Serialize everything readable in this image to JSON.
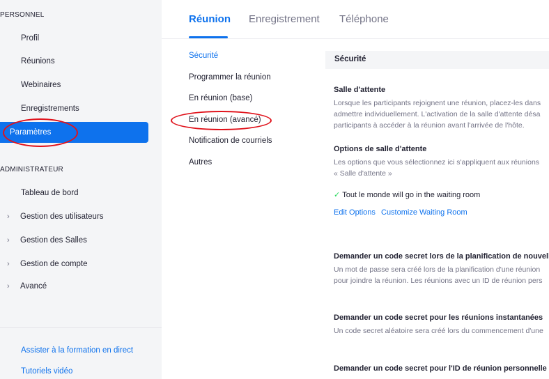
{
  "sidebar": {
    "section_personal": "PERSONNEL",
    "personal_items": [
      {
        "label": "Profil"
      },
      {
        "label": "Réunions"
      },
      {
        "label": "Webinaires"
      },
      {
        "label": "Enregistrements"
      },
      {
        "label": "Paramètres"
      }
    ],
    "section_admin": "ADMINISTRATEUR",
    "admin_items": [
      {
        "label": "Tableau de bord"
      },
      {
        "label": "Gestion des utilisateurs"
      },
      {
        "label": "Gestion des Salles"
      },
      {
        "label": "Gestion de compte"
      },
      {
        "label": "Avancé"
      }
    ],
    "footer_links": [
      {
        "label": "Assister à la formation en direct"
      },
      {
        "label": "Tutoriels vidéo"
      }
    ]
  },
  "tabs": [
    {
      "label": "Réunion",
      "active": true
    },
    {
      "label": "Enregistrement",
      "active": false
    },
    {
      "label": "Téléphone",
      "active": false
    }
  ],
  "subnav": [
    {
      "label": "Sécurité"
    },
    {
      "label": "Programmer la réunion"
    },
    {
      "label": "En réunion (base)"
    },
    {
      "label": "En réunion (avancé)"
    },
    {
      "label": "Notification de courriels"
    },
    {
      "label": "Autres"
    }
  ],
  "content": {
    "section_title": "Sécurité",
    "waiting_room": {
      "title": "Salle d'attente",
      "desc": [
        "Lorsque les participants rejoignent une réunion, placez-les dans",
        "admettre individuellement. L'activation de la salle d'attente désa",
        "participants à accéder à la réunion avant l'arrivée de l'hôte."
      ]
    },
    "waiting_options": {
      "title": "Options de salle d'attente",
      "desc": [
        "Les options que vous sélectionnez ici s'appliquent aux réunions",
        "« Salle d'attente »"
      ],
      "check_label": "Tout le monde will go in the waiting room",
      "edit_options": "Edit Options",
      "customize": "Customize Waiting Room"
    },
    "passcode_schedule": {
      "title": "Demander un code secret lors de la planification de nouvelles r",
      "desc": [
        "Un mot de passe sera créé lors de la planification d'une réunion",
        "pour joindre la réunion. Les réunions avec un ID de réunion pers"
      ]
    },
    "passcode_instant": {
      "title": "Demander un code secret pour les réunions instantanées",
      "desc": [
        "Un code secret aléatoire sera créé lors du commencement d'une"
      ]
    },
    "passcode_pmi": {
      "title": "Demander un code secret pour l'ID de réunion personnelle (PM"
    }
  },
  "colors": {
    "accent": "#0e72ed",
    "annotation": "#e0121b",
    "check": "#23d959"
  }
}
